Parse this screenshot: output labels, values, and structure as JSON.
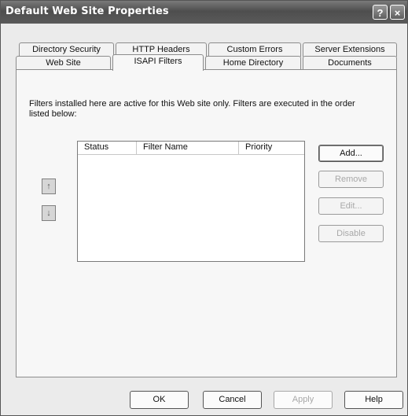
{
  "window": {
    "title": "Default Web Site Properties"
  },
  "title_buttons": {
    "help": "?",
    "close": "×"
  },
  "tabs_back": [
    "Directory Security",
    "HTTP Headers",
    "Custom Errors",
    "Server Extensions"
  ],
  "tabs_front": [
    "Web Site",
    "ISAPI Filters",
    "Home Directory",
    "Documents"
  ],
  "active_tab": "ISAPI Filters",
  "description": "Filters installed here are active for this Web site only. Filters are executed in the order listed below:",
  "filters_list": {
    "columns": [
      "Status",
      "Filter Name",
      "Priority"
    ],
    "rows": []
  },
  "order_buttons": {
    "up": "↑",
    "down": "↓"
  },
  "side_buttons": {
    "add": "Add...",
    "remove": "Remove",
    "edit": "Edit...",
    "disable": "Disable"
  },
  "footer": {
    "ok": "OK",
    "cancel": "Cancel",
    "apply": "Apply",
    "help": "Help"
  }
}
